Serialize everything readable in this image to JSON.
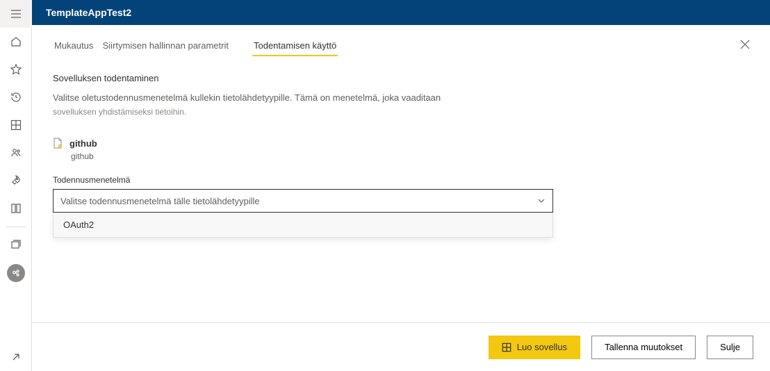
{
  "header": {
    "title": "TemplateAppTest2"
  },
  "tabs": {
    "t1": "Mukautus",
    "t2": "Siirtymisen hallinnan parametrit",
    "t3": "Todentamisen käyttö"
  },
  "section": {
    "title": "Sovelluksen todentaminen",
    "desc": "Valitse oletustodennusmenetelmä kullekin tietolähdetyypille. Tämä on menetelmä, joka vaaditaan",
    "desc2": "sovelluksen yhdistämiseksi tietoihin."
  },
  "datasource": {
    "name": "github",
    "sub": "github"
  },
  "field": {
    "label": "Todennusmenetelmä",
    "placeholder": "Valitse todennusmenetelmä tälle tietolähdetyypille",
    "options": {
      "o1": "OAuth2"
    }
  },
  "footer": {
    "primary": "Luo sovellus",
    "save": "Tallenna muutokset",
    "close": "Sulje"
  },
  "nav": {
    "hamburger": "hamburger",
    "home": "home",
    "star": "star",
    "clock": "clock",
    "grid": "grid",
    "people": "people",
    "rocket": "rocket",
    "book": "book",
    "stack": "stack",
    "badge": "badge",
    "external": "external"
  }
}
